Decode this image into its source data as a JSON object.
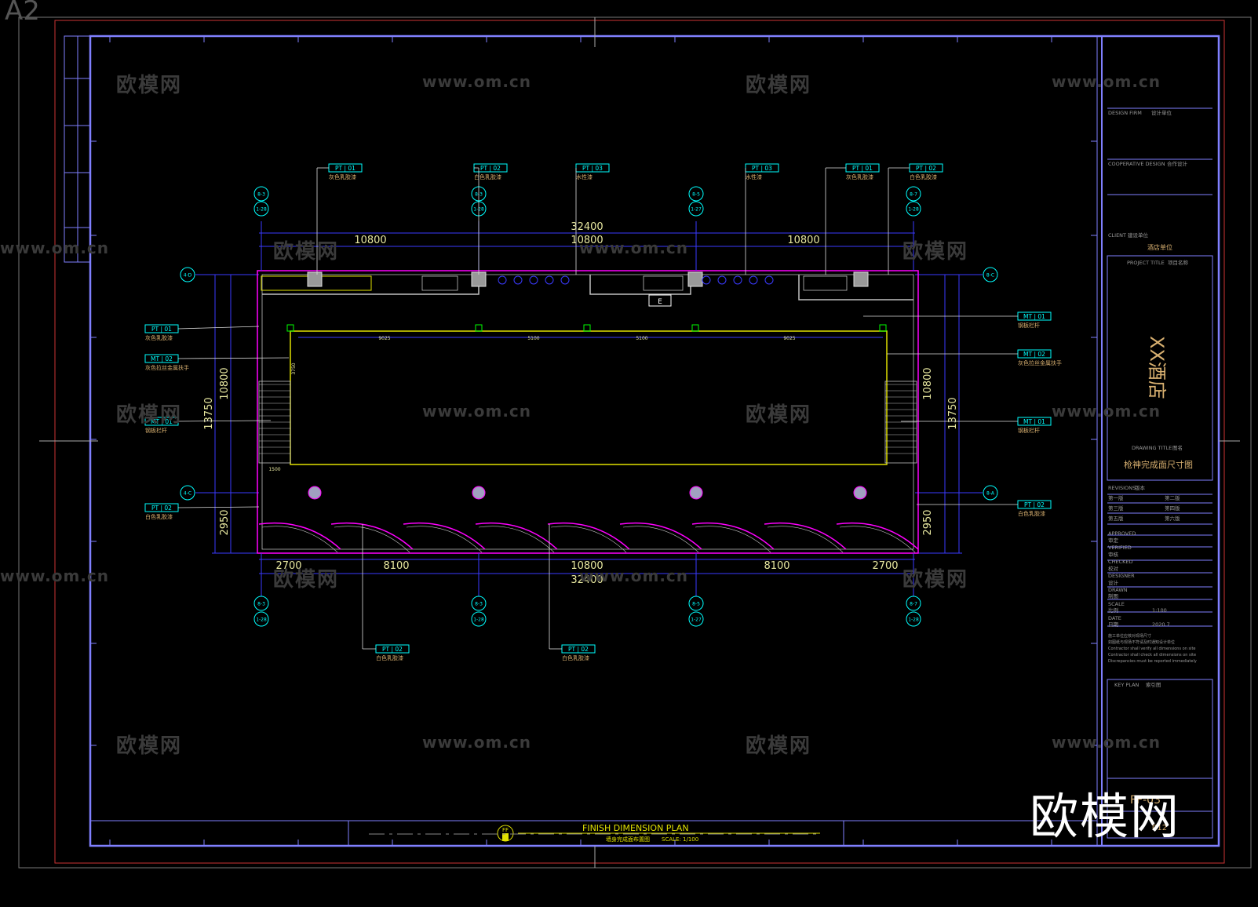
{
  "sheet": {
    "size_mark": "A2",
    "watermark_cn": "欧模网",
    "watermark_url": "www.om.cn",
    "logo": "欧模网"
  },
  "plan": {
    "title_en": "FINISH DIMENSION PLAN",
    "title_cn": "墙身完成面布置图",
    "scale": "SCALE: 1/100",
    "title_symbol": "FF",
    "entrance_mark": "E",
    "overall_width": "32400",
    "top_bays": [
      "10800",
      "10800",
      "10800"
    ],
    "bottom_bays": [
      "2700",
      "8100",
      "10800",
      "8100",
      "2700"
    ],
    "left_heights": [
      "13750",
      "10800",
      "2950"
    ],
    "right_heights": [
      "10800",
      "13750",
      "2950"
    ],
    "inner_spacing": [
      "9025",
      "5100",
      "5100",
      "9025"
    ],
    "stair_dims": [
      "3750",
      "1500"
    ],
    "axes_top": [
      [
        "8-3",
        "1-28"
      ],
      [
        "8-3",
        "1-28"
      ],
      [
        "8-5",
        "1-27"
      ],
      [
        "8-7",
        "1-28"
      ]
    ],
    "axes_bottom": [
      [
        "8-3",
        "1-28"
      ],
      [
        "8-3",
        "1-28"
      ],
      [
        "8-5",
        "1-27"
      ],
      [
        "8-7",
        "1-28"
      ]
    ],
    "axes_left": [
      "4-D",
      "4-C"
    ],
    "axes_right": [
      "8-C",
      "8-A"
    ]
  },
  "tags": {
    "top": [
      {
        "code": "PT | 01",
        "desc": "灰色乳胶漆"
      },
      {
        "code": "PT | 02",
        "desc": "白色乳胶漆"
      },
      {
        "code": "PT | 03",
        "desc": "水性漆"
      },
      {
        "code": "PT | 03",
        "desc": "水性漆"
      },
      {
        "code": "PT | 01",
        "desc": "灰色乳胶漆"
      },
      {
        "code": "PT | 02",
        "desc": "白色乳胶漆"
      }
    ],
    "left": [
      {
        "code": "PT | 01",
        "desc": "灰色乳胶漆"
      },
      {
        "code": "MT | 02",
        "desc": "灰色拉丝金属扶手"
      },
      {
        "code": "MT | 01",
        "desc": "钢板栏杆"
      },
      {
        "code": "PT | 02",
        "desc": "白色乳胶漆"
      }
    ],
    "right": [
      {
        "code": "MT | 01",
        "desc": "钢板栏杆"
      },
      {
        "code": "MT | 02",
        "desc": "灰色拉丝金属扶手"
      },
      {
        "code": "MT | 01",
        "desc": "钢板栏杆"
      },
      {
        "code": "PT | 02",
        "desc": "白色乳胶漆"
      }
    ],
    "bottom": [
      {
        "code": "PT | 02",
        "desc": "白色乳胶漆"
      },
      {
        "code": "PT | 02",
        "desc": "白色乳胶漆"
      }
    ]
  },
  "title_block": {
    "design_firm": "DESIGN FIRM",
    "design_firm_cn": "设计单位",
    "cooperative": "COOPERATIVE DESIGN",
    "cooperative_cn": "合作设计",
    "client": "CLIENT",
    "client_cn": "建设单位",
    "client_name": "酒店单位",
    "project_title": "PROJECT TITLE",
    "project_title_cn": "项目名称",
    "project_name": "XX酒店",
    "drawing_title": "DRAWING TITLE",
    "drawing_title_cn": "图名",
    "drawing_name": "枪神完成面尺寸图",
    "revisions": "REVISIONS",
    "revisions_cn": "版本",
    "revision_rows": [
      [
        "第一版",
        "第二版"
      ],
      [
        "第三版",
        "第四版"
      ],
      [
        "第五版",
        "第六版"
      ]
    ],
    "approved": "APPROVED",
    "approved_cn": "审定",
    "verified": "VERIFIED",
    "verified_cn": "审核",
    "checked": "CHECKED",
    "checked_cn": "校对",
    "designer": "DESIGNER",
    "designer_cn": "设计",
    "drawn": "DRAWN",
    "drawn_cn": "制图",
    "scale": "SCALE",
    "scale_cn": "比例",
    "scale_value": "1:100",
    "date": "DATE",
    "date_cn": "日期",
    "date_value": "2020.7",
    "notes": [
      "施工单位应核对现场尺寸",
      "如图纸与现场不符请及时通知设计单位",
      "Contractor shall verify all dimensions on site",
      "Contractor shall check all dimensions on site",
      "Discrepancies must be reported immediately"
    ],
    "key_plan": "KEY PLAN",
    "key_plan_cn": "索引图",
    "sheet_no": "FF-03",
    "page_no": "012"
  },
  "colors": {
    "frame": "#8080ff",
    "dim": "#3a3aff",
    "wall": "#ff00ff",
    "axis": "#00ffff",
    "tag": "#00ffff",
    "label": "#d8b070",
    "leader": "#e0e000",
    "dimtext": "#e8e8a0"
  }
}
